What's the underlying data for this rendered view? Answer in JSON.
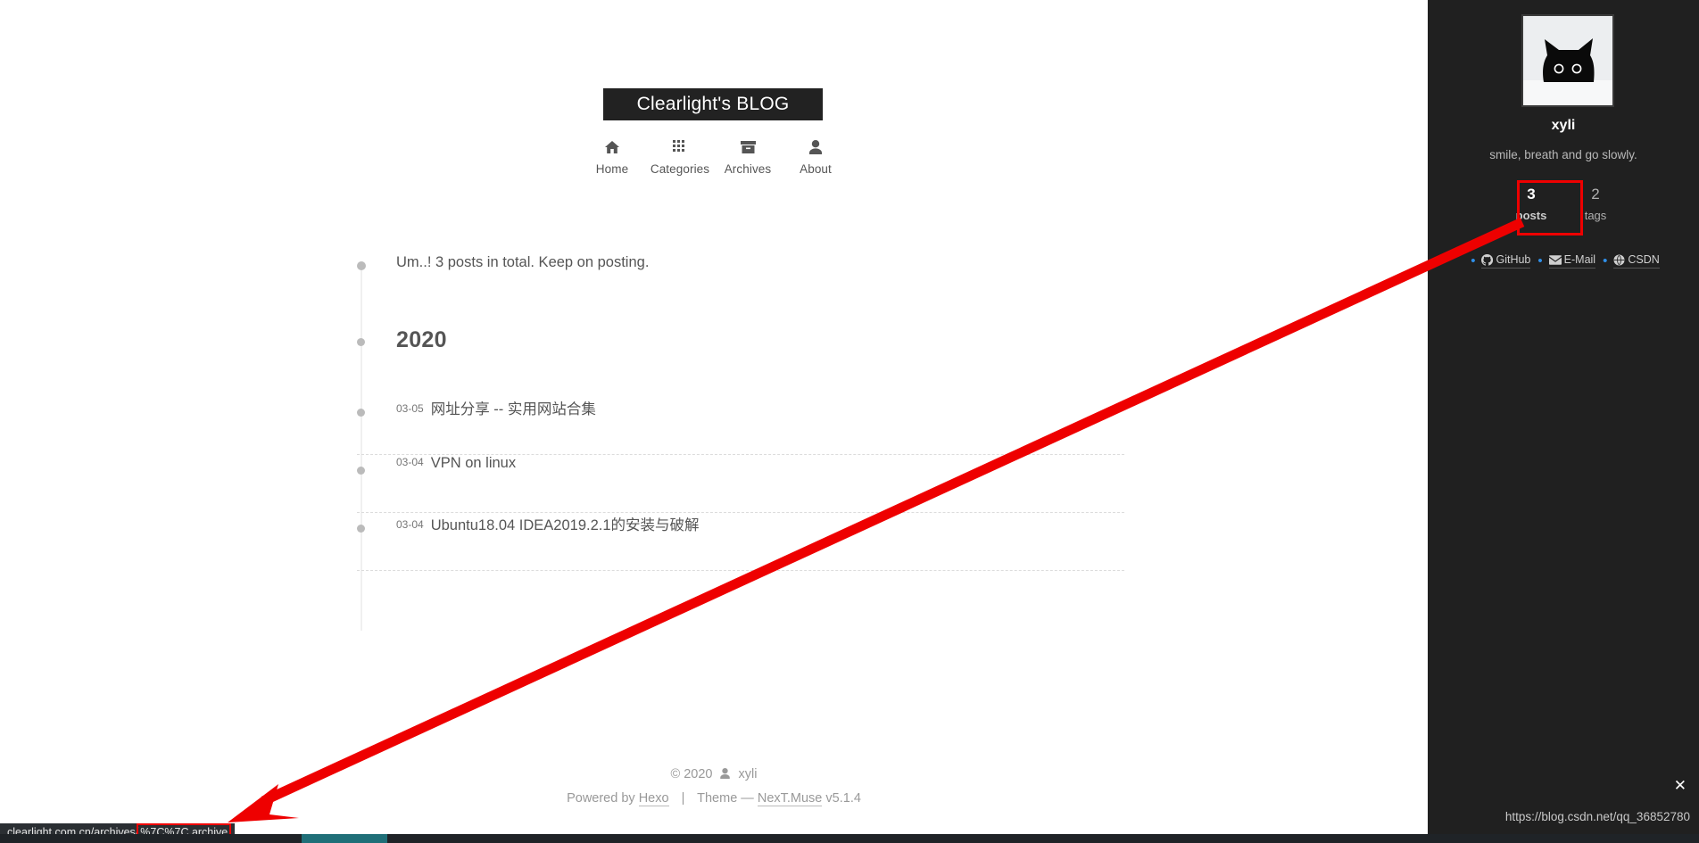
{
  "site": {
    "brand_title": "Clearlight's BLOG"
  },
  "menu": [
    {
      "label": "Home",
      "icon": "home-icon"
    },
    {
      "label": "Categories",
      "icon": "grid-icon"
    },
    {
      "label": "Archives",
      "icon": "archive-box-icon"
    },
    {
      "label": "About",
      "icon": "user-icon"
    }
  ],
  "archive": {
    "collection_title": "Um..! 3 posts in total. Keep on posting.",
    "year": "2020",
    "posts": [
      {
        "date": "03-05",
        "title": "网址分享 -- 实用网站合集"
      },
      {
        "date": "03-04",
        "title": "VPN on linux"
      },
      {
        "date": "03-04",
        "title": "Ubuntu18.04 IDEA2019.2.1的安装与破解"
      }
    ]
  },
  "footer": {
    "copyright_symbol": "©",
    "year": "2020",
    "author": "xyli",
    "powered_by_label": "Powered by",
    "powered_by_link": "Hexo",
    "separator": "|",
    "theme_label": "Theme —",
    "theme_link": "NexT.Muse",
    "theme_version": "v5.1.4"
  },
  "sidebar": {
    "avatar_alt": "black-cat-avatar",
    "author_name": "xyli",
    "author_description": "smile, breath and go slowly.",
    "state": [
      {
        "count": "3",
        "label": "posts"
      },
      {
        "count": "2",
        "label": "tags"
      }
    ],
    "social": [
      {
        "label": "GitHub",
        "icon": "github-icon"
      },
      {
        "label": "E-Mail",
        "icon": "envelope-icon"
      },
      {
        "label": "CSDN",
        "icon": "globe-icon"
      }
    ]
  },
  "watermark": {
    "close_label": "✕",
    "url": "https://blog.csdn.net/qq_36852780"
  },
  "status_bar": {
    "url_prefix": "clearlight.com.cn/archives/",
    "url_highlight": "%7C%7C archive"
  },
  "colors": {
    "annotation_red": "#ee0000",
    "sidebar_bg": "#202020",
    "brand_bg": "#222222",
    "link_blue": "#2f8fe8"
  }
}
